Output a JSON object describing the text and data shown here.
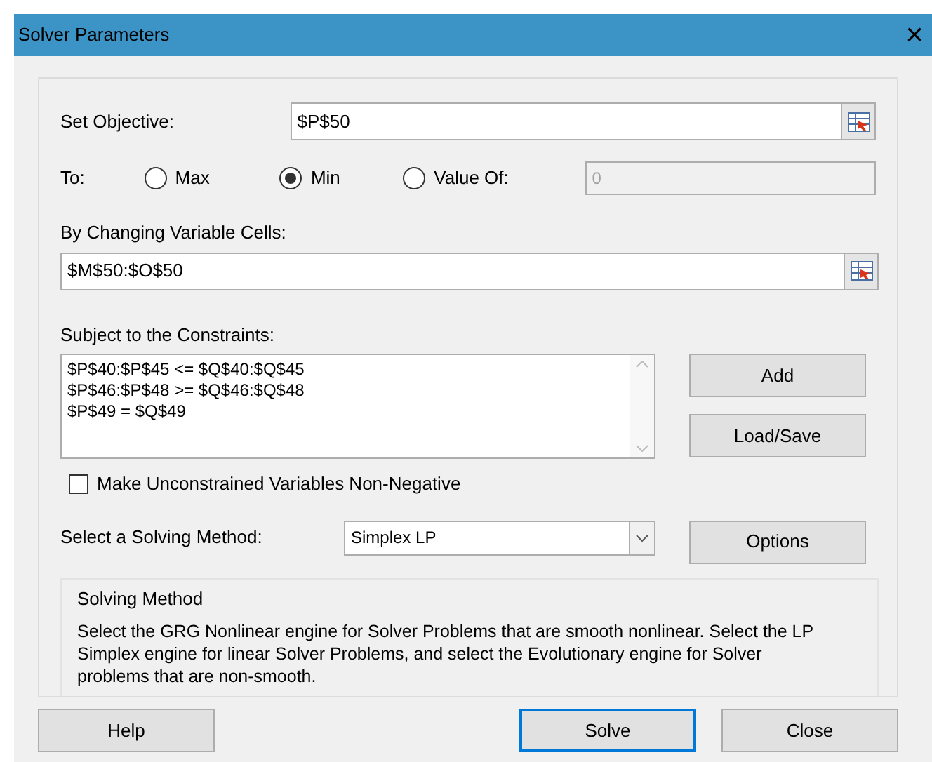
{
  "window": {
    "title": "Solver Parameters",
    "close": "×"
  },
  "objective": {
    "label": "Set Objective:",
    "value": "$P$50"
  },
  "to": {
    "label": "To:",
    "options": [
      {
        "label": "Max",
        "selected": false
      },
      {
        "label": "Min",
        "selected": true
      },
      {
        "label": "Value Of:",
        "selected": false
      }
    ],
    "value_of": {
      "value": "0",
      "disabled": true
    }
  },
  "variables": {
    "label": "By Changing Variable Cells:",
    "value": "$M$50:$O$50"
  },
  "constraints": {
    "label": "Subject to the Constraints:",
    "items": [
      "$P$40:$P$45 <= $Q$40:$Q$45",
      "$P$46:$P$48 >= $Q$46:$Q$48",
      "$P$49 = $Q$49"
    ]
  },
  "side_buttons": [
    "Add",
    "Load/Save"
  ],
  "non_negative": {
    "label": "Make Unconstrained Variables Non-Negative",
    "checked": false
  },
  "method": {
    "label": "Select a Solving Method:",
    "value": "Simplex LP",
    "options_button": "Options"
  },
  "info": {
    "title": "Solving Method",
    "text": "Select the GRG Nonlinear engine for Solver Problems that are smooth nonlinear. Select the LP Simplex engine for linear Solver Problems, and select the Evolutionary engine for Solver problems that are non-smooth."
  },
  "footer": [
    {
      "label": "Help",
      "focused": false
    },
    {
      "label": "Solve",
      "focused": true
    },
    {
      "label": "Close",
      "focused": false
    }
  ]
}
